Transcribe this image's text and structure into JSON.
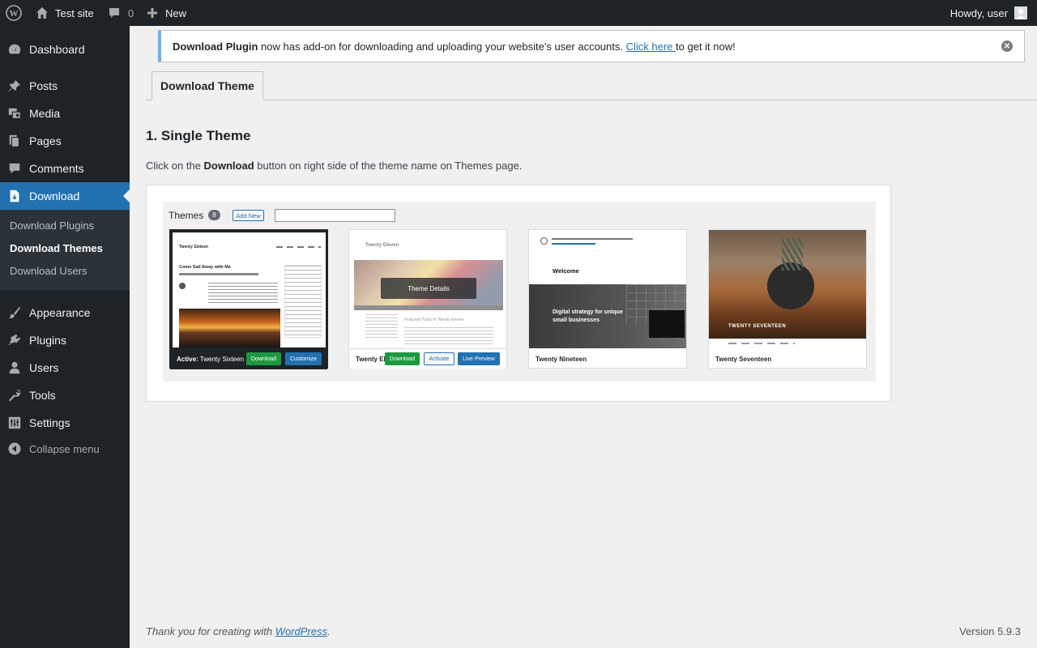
{
  "admin_bar": {
    "site_name": "Test site",
    "comments_count": "0",
    "new_label": "New",
    "greeting": "Howdy, user"
  },
  "sidebar": {
    "items": [
      {
        "label": "Dashboard",
        "icon": "dashboard-icon"
      },
      {
        "label": "Posts",
        "icon": "pin-icon"
      },
      {
        "label": "Media",
        "icon": "media-icon"
      },
      {
        "label": "Pages",
        "icon": "pages-icon"
      },
      {
        "label": "Comments",
        "icon": "comment-icon"
      },
      {
        "label": "Download",
        "icon": "download-doc-icon"
      },
      {
        "label": "Appearance",
        "icon": "brush-icon"
      },
      {
        "label": "Plugins",
        "icon": "plugin-icon"
      },
      {
        "label": "Users",
        "icon": "user-icon"
      },
      {
        "label": "Tools",
        "icon": "wrench-icon"
      },
      {
        "label": "Settings",
        "icon": "settings-icon"
      }
    ],
    "submenu": [
      "Download Plugins",
      "Download Themes",
      "Download Users"
    ],
    "collapse_label": "Collapse menu"
  },
  "notice": {
    "strong": "Download Plugin",
    "text": " now has add-on for downloading and uploading your website's user accounts. ",
    "link": "Click here ",
    "after": "to get it now!"
  },
  "tabs": {
    "active": "Download Theme"
  },
  "section": {
    "title": "1. Single Theme",
    "desc_before": "Click on the ",
    "desc_strong": "Download",
    "desc_after": " button on right side of the theme name on Themes page."
  },
  "screenshot": {
    "title": "Themes",
    "count": "8",
    "add_new": "Add New",
    "themes": [
      {
        "prefix": "Active:",
        "name": "Twenty Sixteen",
        "buttons": [
          "Download",
          "Customize"
        ],
        "preview_title": "Twenty Sixteen",
        "preview_heading": "Come Sail Away with Me"
      },
      {
        "name": "Twenty Eleven",
        "overlay": "Theme Details",
        "buttons": [
          "Download",
          "Activate",
          "Live Preview"
        ],
        "preview_title": "Twenty Eleven",
        "preview_heading": "Featured Posts In Twenty Eleven"
      },
      {
        "name": "Twenty Nineteen",
        "preview_welcome": "Welcome",
        "preview_tagline": "Digital strategy for unique small businesses"
      },
      {
        "name": "Twenty Seventeen",
        "preview_title": "TWENTY SEVENTEEN"
      }
    ]
  },
  "footer": {
    "thanks_before": "Thank you for creating with ",
    "thanks_link": "WordPress",
    "thanks_after": ".",
    "version": "Version 5.9.3"
  }
}
